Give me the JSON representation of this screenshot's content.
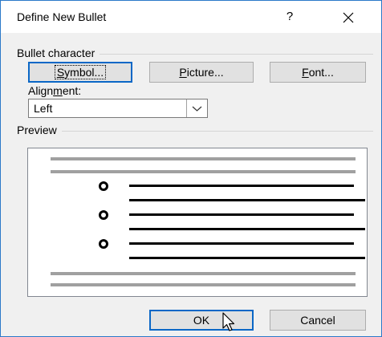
{
  "dialog": {
    "title": "Define New Bullet",
    "help_label": "?",
    "close_icon": "close-icon"
  },
  "bullet_character": {
    "group_label": "Bullet character",
    "symbol_button": {
      "prefix": "",
      "accel": "S",
      "suffix": "ymbol..."
    },
    "picture_button": {
      "prefix": "",
      "accel": "P",
      "suffix": "icture..."
    },
    "font_button": {
      "prefix": "",
      "accel": "F",
      "suffix": "ont..."
    }
  },
  "alignment": {
    "label_prefix": "Align",
    "label_accel": "m",
    "label_suffix": "ent:",
    "selected": "Left",
    "dropdown_icon": "chevron-down-icon"
  },
  "preview": {
    "group_label": "Preview",
    "bullet_items": 3,
    "colors": {
      "placeholder_line": "#a0a0a0",
      "text_line": "#000000"
    }
  },
  "footer": {
    "ok_label": "OK",
    "cancel_label": "Cancel"
  },
  "colors": {
    "window_border": "#2b79c9",
    "dialog_background": "#f0f0f0",
    "focus_border": "#0a67c6"
  }
}
